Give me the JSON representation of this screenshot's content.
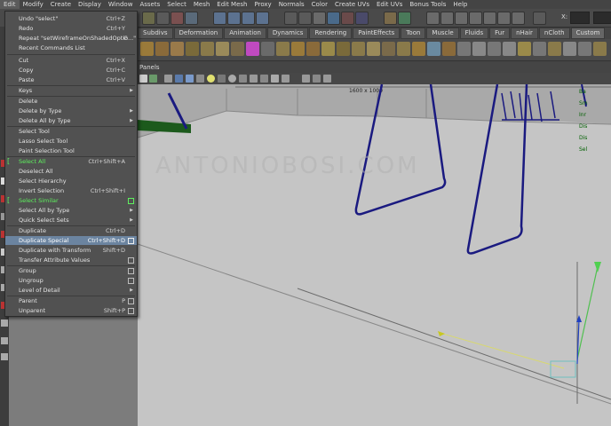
{
  "menubar": {
    "items": [
      "Edit",
      "Modify",
      "Create",
      "Display",
      "Window",
      "Assets",
      "Select",
      "Mesh",
      "Edit Mesh",
      "Proxy",
      "Normals",
      "Color",
      "Create UVs",
      "Edit UVs",
      "Bonus Tools",
      "Help"
    ]
  },
  "toolbar": {
    "xyz_label": "X:"
  },
  "shelf": {
    "tabs": [
      "Subdivs",
      "Deformation",
      "Animation",
      "Dynamics",
      "Rendering",
      "PaintEffects",
      "Toon",
      "Muscle",
      "Fluids",
      "Fur",
      "nHair",
      "nCloth",
      "Custom"
    ],
    "active_tab": "Custom"
  },
  "panel": {
    "menu_label": "Panels",
    "resolution": "1600 x 1000"
  },
  "viewport": {
    "watermark": "ANTONIOBOSI.COM",
    "hud_lines": [
      "Ba",
      "Sm",
      "Inr",
      "Dis",
      "Dis",
      "Sel"
    ]
  },
  "edit_menu": {
    "items": [
      {
        "label": "Undo \"select\"",
        "shortcut": "Ctrl+Z"
      },
      {
        "label": "Redo",
        "shortcut": "Ctrl+Y"
      },
      {
        "label": "Repeat \"setWireframeOnShadedOptio...\"",
        "shortcut": "G"
      },
      {
        "label": "Recent Commands List",
        "shortcut": ""
      },
      {
        "label": "Cut",
        "shortcut": "Ctrl+X"
      },
      {
        "label": "Copy",
        "shortcut": "Ctrl+C"
      },
      {
        "label": "Paste",
        "shortcut": "Ctrl+V"
      },
      {
        "label": "Keys",
        "shortcut": "",
        "submenu": true
      },
      {
        "label": "Delete",
        "shortcut": ""
      },
      {
        "label": "Delete by Type",
        "shortcut": "",
        "submenu": true
      },
      {
        "label": "Delete All by Type",
        "shortcut": "",
        "submenu": true
      },
      {
        "label": "Select Tool",
        "shortcut": ""
      },
      {
        "label": "Lasso Select Tool",
        "shortcut": ""
      },
      {
        "label": "Paint Selection Tool",
        "shortcut": ""
      },
      {
        "label": "Select All",
        "shortcut": "Ctrl+Shift+A",
        "green": true
      },
      {
        "label": "Deselect All",
        "shortcut": ""
      },
      {
        "label": "Select Hierarchy",
        "shortcut": ""
      },
      {
        "label": "Invert Selection",
        "shortcut": "Ctrl+Shift+I"
      },
      {
        "label": "Select Similar",
        "shortcut": "",
        "green": true
      },
      {
        "label": "Select All by Type",
        "shortcut": "",
        "submenu": true
      },
      {
        "label": "Quick Select Sets",
        "shortcut": "",
        "submenu": true
      },
      {
        "label": "Duplicate",
        "shortcut": "Ctrl+D"
      },
      {
        "label": "Duplicate Special",
        "shortcut": "Ctrl+Shift+D",
        "option": true,
        "highlighted": true
      },
      {
        "label": "Duplicate with Transform",
        "shortcut": "Shift+D"
      },
      {
        "label": "Transfer Attribute Values",
        "shortcut": "",
        "option": true
      },
      {
        "label": "Group",
        "shortcut": "",
        "option": true
      },
      {
        "label": "Ungroup",
        "shortcut": "",
        "option": true
      },
      {
        "label": "Level of Detail",
        "shortcut": "",
        "submenu": true
      },
      {
        "label": "Parent",
        "shortcut": "P",
        "option": true
      },
      {
        "label": "Unparent",
        "shortcut": "Shift+P",
        "option": true
      }
    ]
  },
  "colors": {
    "menu_bg": "#515151",
    "highlight": "#6b84a0",
    "green_text": "#5ef05e",
    "wire_blue": "#1a1a80",
    "viewport_floor": "#c5c5c5"
  }
}
